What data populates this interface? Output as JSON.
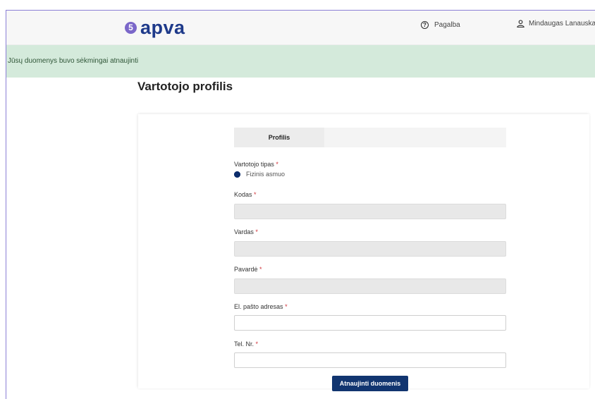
{
  "header": {
    "logo_badge": "5",
    "logo_text": "apva",
    "help_label": "Pagalba",
    "user_name": "Mindaugas Lanauskas",
    "user_caret": "▾"
  },
  "alert": {
    "message": "Jūsų duomenys buvo sėkmingai atnaujinti",
    "color": "#d4eadb"
  },
  "page": {
    "title": "Vartotojo profilis"
  },
  "tabs": [
    {
      "label": "Profilis",
      "active": true
    }
  ],
  "form": {
    "user_type": {
      "label": "Vartotojo tipas",
      "required": "*",
      "option": "Fizinis asmuo",
      "selected": true
    },
    "code": {
      "label": "Kodas",
      "required": "*",
      "value": ""
    },
    "first_name": {
      "label": "Vardas",
      "required": "*",
      "value": ""
    },
    "last_name": {
      "label": "Pavardė",
      "required": "*",
      "value": ""
    },
    "email": {
      "label": "El. pašto adresas",
      "required": "*",
      "value": ""
    },
    "phone": {
      "label": "Tel. Nr.",
      "required": "*",
      "value": ""
    },
    "submit_label": "Atnaujinti duomenis"
  },
  "colors": {
    "brand": "#1e3a8a",
    "badge": "#7b67c9",
    "button": "#113570",
    "required": "#d0343a"
  },
  "icons": {
    "help": "question-circle-icon",
    "user": "user-outline-icon",
    "caret": "chevron-down-icon"
  }
}
